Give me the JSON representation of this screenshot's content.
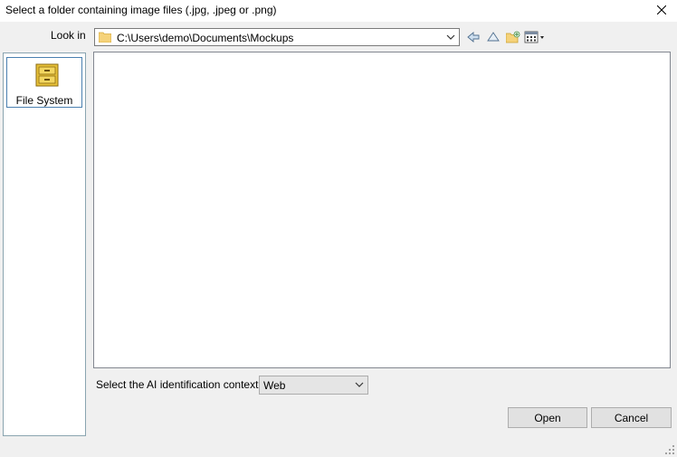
{
  "dialog": {
    "title": "Select a folder containing image files (.jpg, .jpeg or .png)"
  },
  "look_in": {
    "label": "Look in",
    "path": "C:\\Users\\demo\\Documents\\Mockups"
  },
  "toolbar": {
    "icons": [
      "back-icon",
      "up-folder-icon",
      "new-folder-icon",
      "view-menu-icon"
    ]
  },
  "places": {
    "items": [
      {
        "label": "File System",
        "icon": "file-cabinet-icon"
      }
    ]
  },
  "context": {
    "label": "Select the AI identification context",
    "selected": "Web"
  },
  "buttons": {
    "open": "Open",
    "cancel": "Cancel"
  },
  "colors": {
    "folder": "#f5d27a",
    "cabinet": "#e8c23a",
    "selection_border": "#4a7fb0"
  }
}
